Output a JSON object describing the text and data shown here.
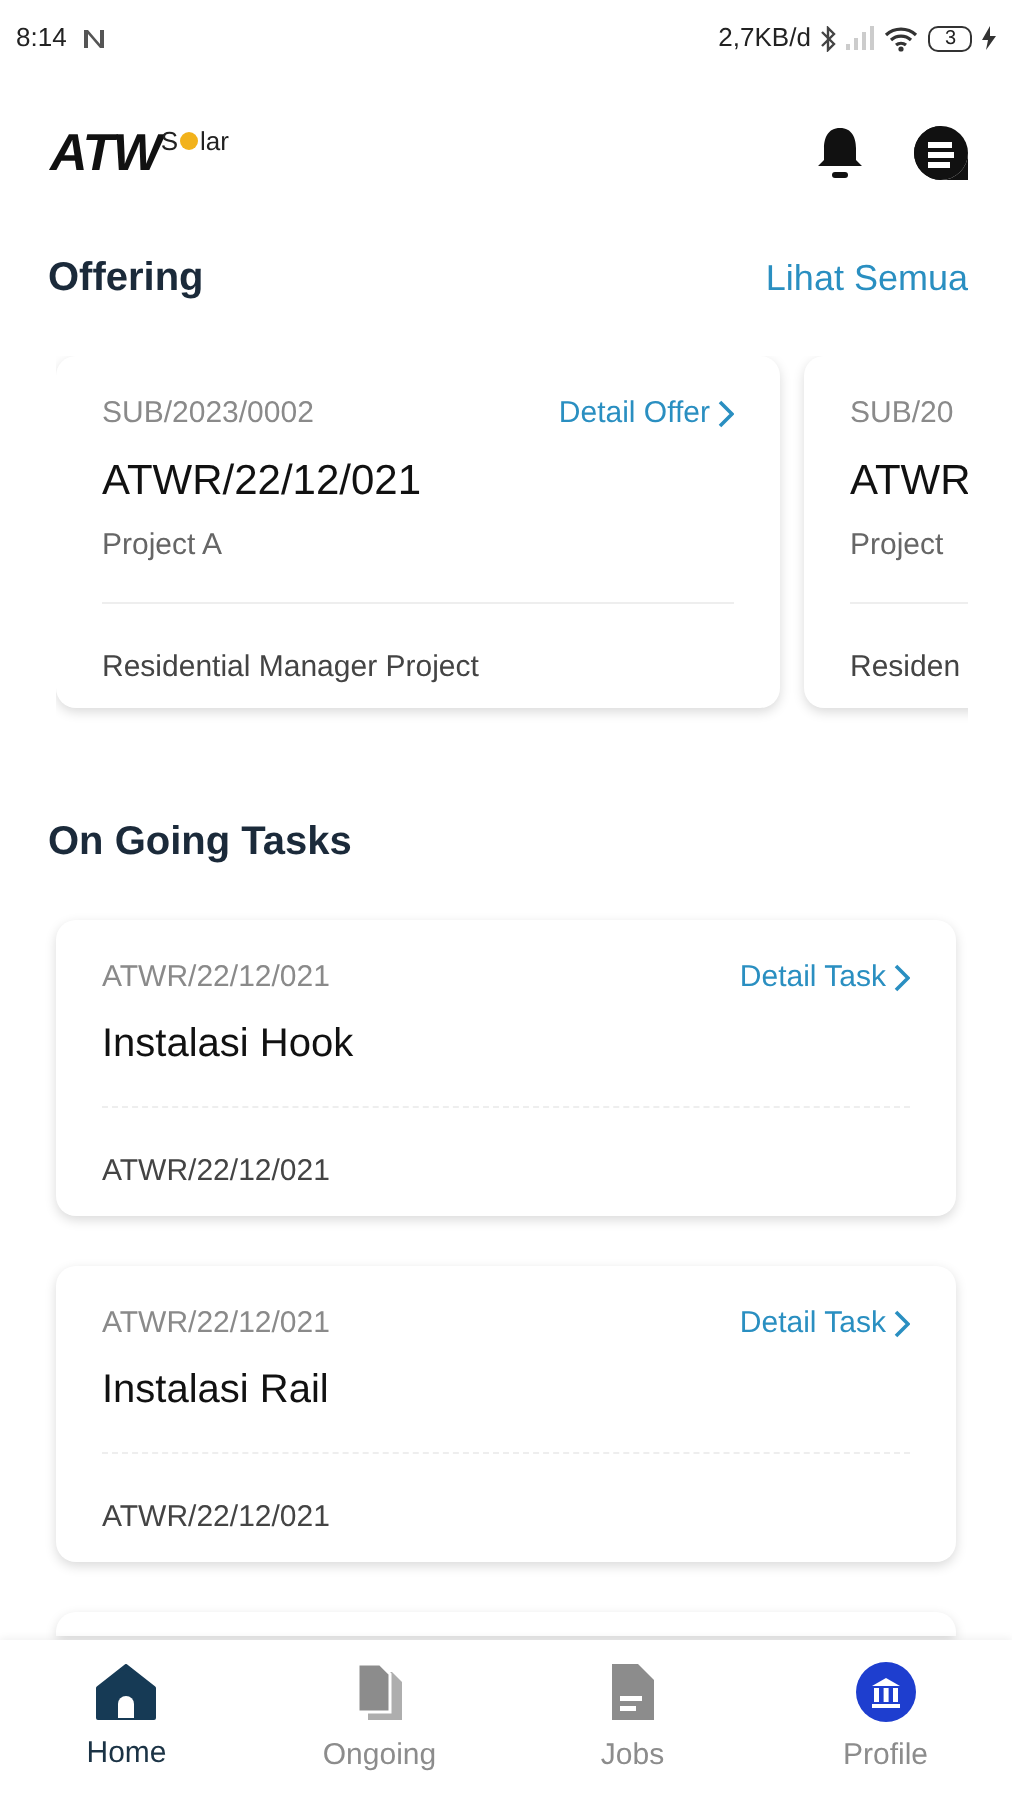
{
  "status_bar": {
    "time": "8:14",
    "network_speed": "2,7KB/d",
    "battery": "3"
  },
  "logo": {
    "main": "ATW",
    "sub_start": "S",
    "sub_end": "lar"
  },
  "offering": {
    "title": "Offering",
    "see_all": "Lihat Semua",
    "cards": [
      {
        "code": "SUB/2023/0002",
        "link": "Detail Offer",
        "number": "ATWR/22/12/021",
        "project": "Project A",
        "role": "Residential Manager Project"
      },
      {
        "code": "SUB/20",
        "number": "ATWR",
        "project": "Project",
        "role": "Residen"
      }
    ]
  },
  "tasks": {
    "title": "On Going Tasks",
    "cards": [
      {
        "code": "ATWR/22/12/021",
        "link": "Detail Task",
        "name": "Instalasi Hook",
        "footer": "ATWR/22/12/021"
      },
      {
        "code": "ATWR/22/12/021",
        "link": "Detail Task",
        "name": "Instalasi Rail",
        "footer": "ATWR/22/12/021"
      }
    ]
  },
  "nav": [
    {
      "kind": "home",
      "label": "Home",
      "selected": true
    },
    {
      "kind": "ongoing",
      "label": "Ongoing",
      "selected": false
    },
    {
      "kind": "jobs",
      "label": "Jobs",
      "selected": false
    },
    {
      "kind": "profile",
      "label": "Profile",
      "selected": false
    }
  ]
}
